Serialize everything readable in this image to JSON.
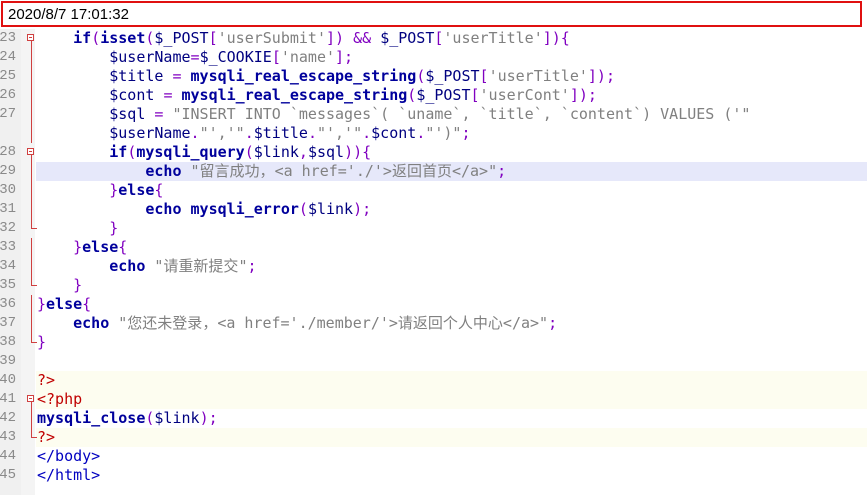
{
  "timestamp": "2020/8/7 17:01:32",
  "editor": {
    "highlight_line": 29,
    "lines": [
      {
        "n": "23",
        "fold": "box",
        "tokens": [
          [
            "plain",
            "    "
          ],
          [
            "kw",
            "if"
          ],
          [
            "punc",
            "("
          ],
          [
            "fn",
            "isset"
          ],
          [
            "punc",
            "("
          ],
          [
            "var",
            "$_POST"
          ],
          [
            "punc",
            "["
          ],
          [
            "str",
            "'userSubmit'"
          ],
          [
            "punc",
            "])"
          ],
          [
            "plain",
            " "
          ],
          [
            "op",
            "&&"
          ],
          [
            "plain",
            " "
          ],
          [
            "var",
            "$_POST"
          ],
          [
            "punc",
            "["
          ],
          [
            "str",
            "'userTitle'"
          ],
          [
            "punc",
            "]){"
          ]
        ]
      },
      {
        "n": "24",
        "fold": "line",
        "tokens": [
          [
            "plain",
            "        "
          ],
          [
            "var",
            "$userName"
          ],
          [
            "op",
            "="
          ],
          [
            "var",
            "$_COOKIE"
          ],
          [
            "punc",
            "["
          ],
          [
            "str",
            "'name'"
          ],
          [
            "punc",
            "];"
          ]
        ]
      },
      {
        "n": "25",
        "fold": "line",
        "tokens": [
          [
            "plain",
            "        "
          ],
          [
            "var",
            "$title"
          ],
          [
            "plain",
            " "
          ],
          [
            "op",
            "="
          ],
          [
            "plain",
            " "
          ],
          [
            "fn",
            "mysqli_real_escape_string"
          ],
          [
            "punc",
            "("
          ],
          [
            "var",
            "$_POST"
          ],
          [
            "punc",
            "["
          ],
          [
            "str",
            "'userTitle'"
          ],
          [
            "punc",
            "]);"
          ]
        ]
      },
      {
        "n": "26",
        "fold": "line",
        "tokens": [
          [
            "plain",
            "        "
          ],
          [
            "var",
            "$cont"
          ],
          [
            "plain",
            " "
          ],
          [
            "op",
            "="
          ],
          [
            "plain",
            " "
          ],
          [
            "fn",
            "mysqli_real_escape_string"
          ],
          [
            "punc",
            "("
          ],
          [
            "var",
            "$_POST"
          ],
          [
            "punc",
            "["
          ],
          [
            "str",
            "'userCont'"
          ],
          [
            "punc",
            "]);"
          ]
        ]
      },
      {
        "n": "27",
        "fold": "line",
        "tokens": [
          [
            "plain",
            "        "
          ],
          [
            "var",
            "$sql"
          ],
          [
            "plain",
            " "
          ],
          [
            "op",
            "="
          ],
          [
            "plain",
            " "
          ],
          [
            "str",
            "\"INSERT INTO `messages`( `uname`, `title`, `content`) VALUES ('\""
          ]
        ]
      },
      {
        "n": "",
        "fold": "line",
        "tokens": [
          [
            "plain",
            "        "
          ],
          [
            "var",
            "$userName"
          ],
          [
            "op",
            "."
          ],
          [
            "str",
            "\"','\""
          ],
          [
            "op",
            "."
          ],
          [
            "var",
            "$title"
          ],
          [
            "op",
            "."
          ],
          [
            "str",
            "\"','\""
          ],
          [
            "op",
            "."
          ],
          [
            "var",
            "$cont"
          ],
          [
            "op",
            "."
          ],
          [
            "str",
            "\"')\""
          ],
          [
            "punc",
            ";"
          ]
        ]
      },
      {
        "n": "28",
        "fold": "box",
        "tokens": [
          [
            "plain",
            "        "
          ],
          [
            "kw",
            "if"
          ],
          [
            "punc",
            "("
          ],
          [
            "fn",
            "mysqli_query"
          ],
          [
            "punc",
            "("
          ],
          [
            "var",
            "$link"
          ],
          [
            "punc",
            ","
          ],
          [
            "var",
            "$sql"
          ],
          [
            "punc",
            ")){"
          ]
        ]
      },
      {
        "n": "29",
        "fold": "line",
        "tokens": [
          [
            "plain",
            "            "
          ],
          [
            "kw",
            "echo"
          ],
          [
            "plain",
            " "
          ],
          [
            "str",
            "\"留言成功，<a href='./'>返回首页</a>\""
          ],
          [
            "punc",
            ";"
          ]
        ]
      },
      {
        "n": "30",
        "fold": "line",
        "tokens": [
          [
            "plain",
            "        "
          ],
          [
            "punc",
            "}"
          ],
          [
            "kw",
            "else"
          ],
          [
            "punc",
            "{"
          ]
        ]
      },
      {
        "n": "31",
        "fold": "line",
        "tokens": [
          [
            "plain",
            "            "
          ],
          [
            "kw",
            "echo"
          ],
          [
            "plain",
            " "
          ],
          [
            "fn",
            "mysqli_error"
          ],
          [
            "punc",
            "("
          ],
          [
            "var",
            "$link"
          ],
          [
            "punc",
            ");"
          ]
        ]
      },
      {
        "n": "32",
        "fold": "corner",
        "tokens": [
          [
            "plain",
            "        "
          ],
          [
            "punc",
            "}"
          ]
        ]
      },
      {
        "n": "33",
        "fold": "line",
        "tokens": [
          [
            "plain",
            "    "
          ],
          [
            "punc",
            "}"
          ],
          [
            "kw",
            "else"
          ],
          [
            "punc",
            "{"
          ]
        ]
      },
      {
        "n": "34",
        "fold": "line",
        "tokens": [
          [
            "plain",
            "        "
          ],
          [
            "kw",
            "echo"
          ],
          [
            "plain",
            " "
          ],
          [
            "str",
            "\"请重新提交\""
          ],
          [
            "punc",
            ";"
          ]
        ]
      },
      {
        "n": "35",
        "fold": "corner",
        "tokens": [
          [
            "plain",
            "    "
          ],
          [
            "punc",
            "}"
          ]
        ]
      },
      {
        "n": "36",
        "fold": "line",
        "tokens": [
          [
            "punc",
            "}"
          ],
          [
            "kw",
            "else"
          ],
          [
            "punc",
            "{"
          ]
        ]
      },
      {
        "n": "37",
        "fold": "line",
        "tokens": [
          [
            "plain",
            "    "
          ],
          [
            "kw",
            "echo"
          ],
          [
            "plain",
            " "
          ],
          [
            "str",
            "\"您还未登录，<a href='./member/'>请返回个人中心</a>\""
          ],
          [
            "punc",
            ";"
          ]
        ]
      },
      {
        "n": "38",
        "fold": "corner",
        "tokens": [
          [
            "punc",
            "}"
          ]
        ]
      },
      {
        "n": "39",
        "fold": "none",
        "tokens": []
      },
      {
        "n": "40",
        "fold": "none",
        "tag_line": true,
        "tokens": [
          [
            "tag",
            "?>"
          ]
        ]
      },
      {
        "n": "41",
        "fold": "box",
        "tag_line": true,
        "tokens": [
          [
            "tag",
            "<?php"
          ]
        ]
      },
      {
        "n": "42",
        "fold": "line",
        "tokens": [
          [
            "fn",
            "mysqli_close"
          ],
          [
            "punc",
            "("
          ],
          [
            "var",
            "$link"
          ],
          [
            "punc",
            ");"
          ]
        ]
      },
      {
        "n": "43",
        "fold": "corner",
        "tag_line": true,
        "tokens": [
          [
            "tag",
            "?>"
          ]
        ]
      },
      {
        "n": "44",
        "fold": "none",
        "tokens": [
          [
            "htag",
            "</body>"
          ]
        ]
      },
      {
        "n": "45",
        "fold": "none",
        "tokens": [
          [
            "htag",
            "</html>"
          ]
        ]
      }
    ]
  }
}
